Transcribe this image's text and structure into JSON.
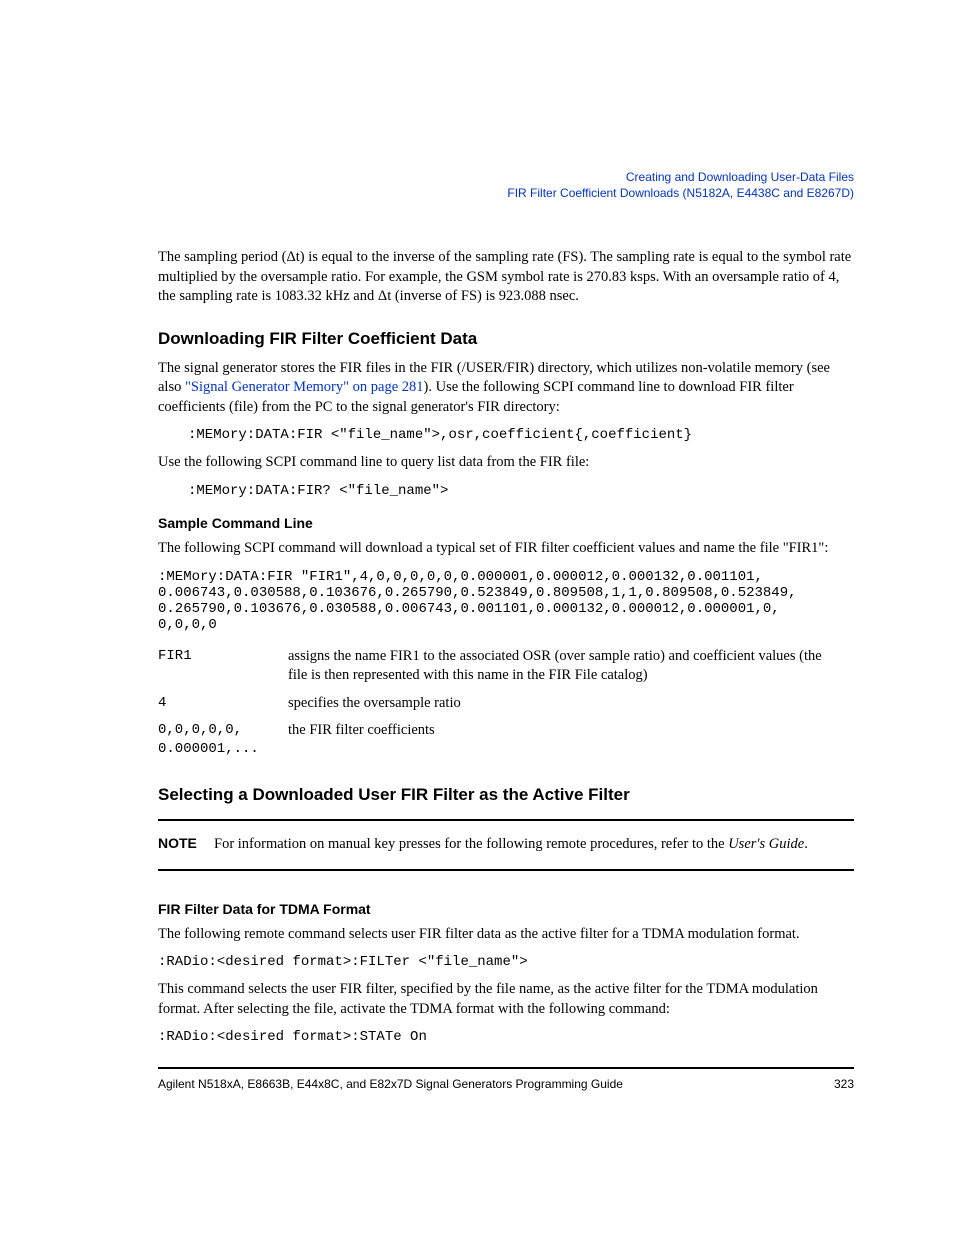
{
  "header": {
    "line1": "Creating and Downloading User-Data Files",
    "line2": "FIR Filter Coefficient Downloads (N5182A, E4438C and E8267D)"
  },
  "intro_para": "The sampling period (Δt) is equal to the inverse of the sampling rate (FS). The sampling rate is equal to the symbol rate multiplied by the oversample ratio. For example, the GSM symbol rate is 270.83 ksps. With an oversample ratio of 4, the sampling rate is 1083.32 kHz and Δt (inverse of FS) is 923.088 nsec.",
  "section1": {
    "heading": "Downloading FIR Filter Coefficient Data",
    "p1_pre": "The signal generator stores the FIR files in the FIR (/USER/FIR) directory, which utilizes non-volatile memory (see also ",
    "p1_link": "\"Signal Generator Memory\" on page 281",
    "p1_post": "). Use the following SCPI command line to download FIR filter coefficients (file) from the PC to the signal generator's FIR directory:",
    "cmd1": ":MEMory:DATA:FIR <\"file_name\">,osr,coefficient{,coefficient}",
    "p2": "Use the following SCPI command line to query list data from the FIR file:",
    "cmd2": ":MEMory:DATA:FIR? <\"file_name\">"
  },
  "sample": {
    "heading": "Sample Command Line",
    "p1": "The following SCPI command will download a typical set of FIR filter coefficient values and name the file \"FIR1\":",
    "cmd": ":MEMory:DATA:FIR \"FIR1\",4,0,0,0,0,0,0.000001,0.000012,0.000132,0.001101,\n0.006743,0.030588,0.103676,0.265790,0.523849,0.809508,1,1,0.809508,0.523849,\n0.265790,0.103676,0.030588,0.006743,0.001101,0.000132,0.000012,0.000001,0,\n0,0,0,0",
    "defs": [
      {
        "term": "FIR1",
        "desc": "assigns the name FIR1 to the associated OSR (over sample ratio) and coefficient values (the file is then represented with this name in the FIR File catalog)"
      },
      {
        "term": "4",
        "desc": "specifies the oversample ratio"
      },
      {
        "term": "0,0,0,0,0,\n0.000001,...",
        "desc": "the FIR filter coefficients"
      }
    ]
  },
  "section2": {
    "heading": "Selecting a Downloaded User FIR Filter as the Active Filter",
    "note_label": "NOTE",
    "note_text_pre": "For information on manual key presses for the following remote procedures, refer to the ",
    "note_text_em": "User's Guide",
    "note_text_post": "."
  },
  "tdma": {
    "heading": "FIR Filter Data for TDMA Format",
    "p1": "The following remote command selects user FIR filter data as the active filter for a TDMA modulation format.",
    "cmd1": ":RADio:<desired format>:FILTer <\"file_name\">",
    "p2": "This command selects the user FIR filter, specified by the file name, as the active filter for the TDMA modulation format. After selecting the file, activate the TDMA format with the following command:",
    "cmd2": ":RADio:<desired format>:STATe On"
  },
  "footer": {
    "left": "Agilent N518xA, E8663B, E44x8C, and E82x7D Signal Generators Programming Guide",
    "right": "323"
  }
}
